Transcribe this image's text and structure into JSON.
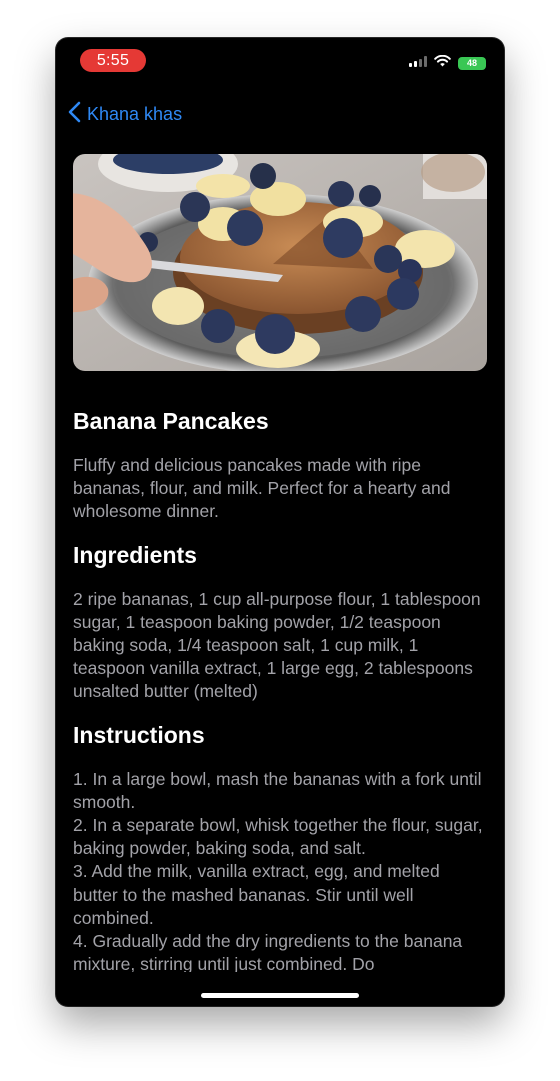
{
  "status_bar": {
    "time": "5:55",
    "battery": "48",
    "icons": [
      "cellular-signal-icon",
      "wifi-icon",
      "battery-charging-icon"
    ]
  },
  "nav": {
    "back_label": "Khana khas",
    "back_icon": "chevron-left-icon"
  },
  "hero_image": {
    "subject": "photo-banana-pancakes"
  },
  "recipe": {
    "title": "Banana Pancakes",
    "description": "Fluffy and delicious pancakes made with ripe bananas, flour, and milk. Perfect for a hearty and wholesome dinner.",
    "ingredients_heading": "Ingredients",
    "ingredients_text": "2 ripe bananas, 1 cup all-purpose flour, 1 tablespoon sugar, 1 teaspoon baking powder, 1/2 teaspoon baking soda, 1/4 teaspoon salt, 1 cup milk, 1 teaspoon vanilla extract, 1 large egg, 2 tablespoons unsalted butter (melted)",
    "instructions_heading": "Instructions",
    "instructions_text": "1. In a large bowl, mash the bananas with a fork until smooth.\n2. In a separate bowl, whisk together the flour, sugar, baking powder, baking soda, and salt.\n3. Add the milk, vanilla extract, egg, and melted butter to the mashed bananas. Stir until well combined.\n4. Gradually add the dry ingredients to the banana mixture, stirring until just combined. Do"
  },
  "colors": {
    "background": "#000000",
    "accent": "#2f89f5",
    "time_pill": "#e53935",
    "battery": "#39c754",
    "body_text": "#a2a2a8"
  }
}
